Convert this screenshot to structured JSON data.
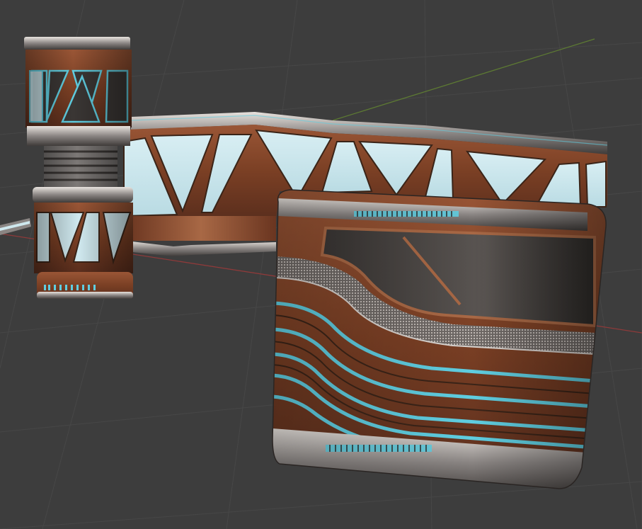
{
  "scene": {
    "kind": "3d-viewport-render",
    "objects": [
      {
        "name": "pillar",
        "material": "wood-metal-glow"
      },
      {
        "name": "truss-wall-panel",
        "material": "wood-metal-glow"
      },
      {
        "name": "curved-wall-panel",
        "material": "wood-metal-glow"
      }
    ]
  },
  "colors": {
    "background": "#3d3d3d",
    "grid_line": "#454545",
    "axis_x": "#9b3a3a",
    "axis_y": "#5e7a33",
    "wood_dark": "#5a2e1d",
    "wood": "#8a4a2c",
    "wood_light": "#a86845",
    "glass": "#cfe8ee",
    "glow": "#5fcde0",
    "metal_dark": "#3a3735",
    "metal": "#7c7876",
    "metal_light": "#d9d4d0"
  }
}
